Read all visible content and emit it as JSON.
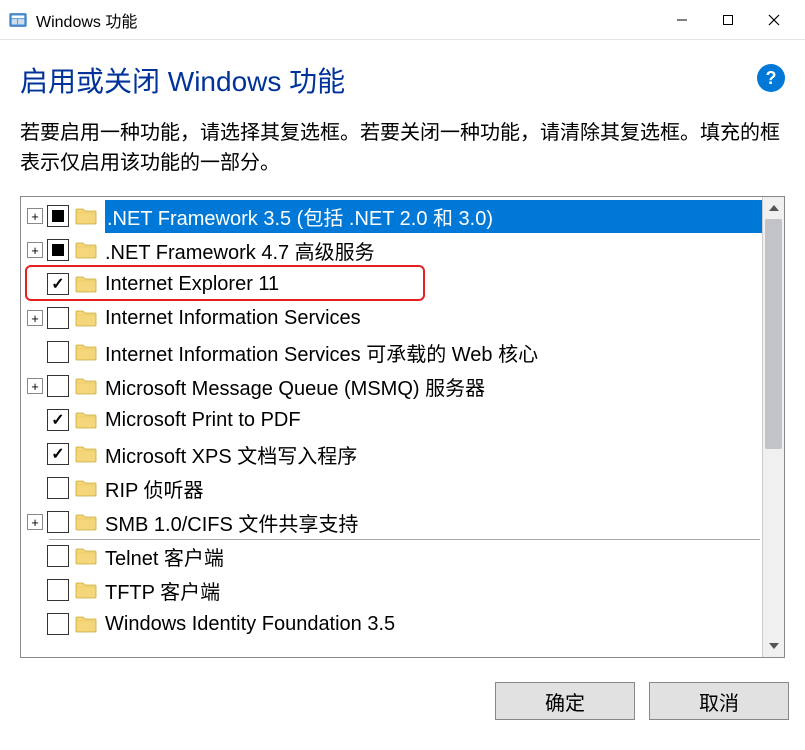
{
  "titlebar": {
    "title": "Windows 功能"
  },
  "header": {
    "heading": "启用或关闭 Windows 功能",
    "help_tooltip": "?"
  },
  "description": "若要启用一种功能，请选择其复选框。若要关闭一种功能，请清除其复选框。填充的框表示仅启用该功能的一部分。",
  "items": [
    {
      "label": ".NET Framework 3.5 (包括 .NET 2.0 和 3.0)",
      "expandable": true,
      "state": "partial",
      "selected": true
    },
    {
      "label": ".NET Framework 4.7 高级服务",
      "expandable": true,
      "state": "partial",
      "selected": false
    },
    {
      "label": "Internet Explorer 11",
      "expandable": false,
      "state": "checked",
      "selected": false,
      "highlighted": true
    },
    {
      "label": "Internet Information Services",
      "expandable": true,
      "state": "unchecked",
      "selected": false
    },
    {
      "label": "Internet Information Services 可承载的 Web 核心",
      "expandable": false,
      "state": "unchecked",
      "selected": false
    },
    {
      "label": "Microsoft Message Queue (MSMQ) 服务器",
      "expandable": true,
      "state": "unchecked",
      "selected": false
    },
    {
      "label": "Microsoft Print to PDF",
      "expandable": false,
      "state": "checked",
      "selected": false
    },
    {
      "label": "Microsoft XPS 文档写入程序",
      "expandable": false,
      "state": "checked",
      "selected": false
    },
    {
      "label": "RIP 侦听器",
      "expandable": false,
      "state": "unchecked",
      "selected": false
    },
    {
      "label": "SMB 1.0/CIFS 文件共享支持",
      "expandable": true,
      "state": "unchecked",
      "selected": false,
      "divider_after": true
    },
    {
      "label": "Telnet 客户端",
      "expandable": false,
      "state": "unchecked",
      "selected": false
    },
    {
      "label": "TFTP 客户端",
      "expandable": false,
      "state": "unchecked",
      "selected": false
    },
    {
      "label": "Windows Identity Foundation 3.5",
      "expandable": false,
      "state": "unchecked",
      "selected": false
    }
  ],
  "buttons": {
    "ok": "确定",
    "cancel": "取消"
  }
}
